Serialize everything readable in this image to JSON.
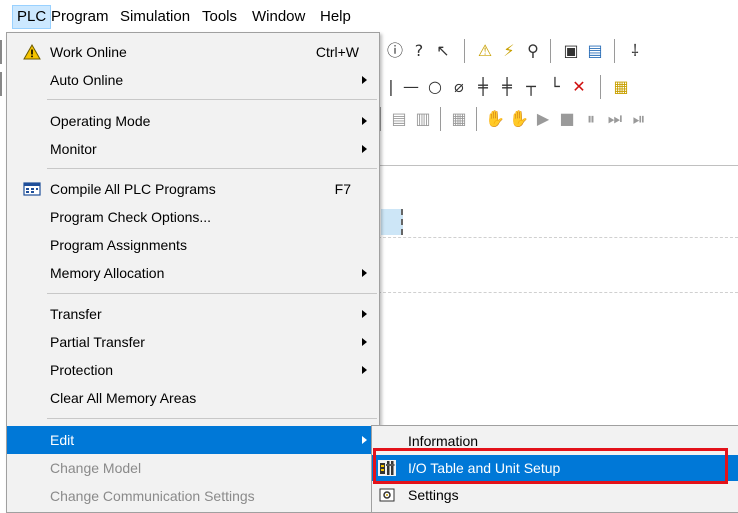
{
  "menubar": {
    "items": [
      {
        "label": "PLC",
        "active": true
      },
      {
        "label": "Program"
      },
      {
        "label": "Simulation"
      },
      {
        "label": "Tools"
      },
      {
        "label": "Window"
      },
      {
        "label": "Help"
      }
    ]
  },
  "plc_menu": {
    "work_online": {
      "label": "Work Online",
      "shortcut": "Ctrl+W"
    },
    "auto_online": {
      "label": "Auto Online"
    },
    "operating_mode": {
      "label": "Operating Mode"
    },
    "monitor": {
      "label": "Monitor"
    },
    "compile_all": {
      "label": "Compile All PLC Programs",
      "shortcut": "F7"
    },
    "program_check": {
      "label": "Program Check Options..."
    },
    "program_assignments": {
      "label": "Program Assignments"
    },
    "memory_allocation": {
      "label": "Memory Allocation"
    },
    "transfer": {
      "label": "Transfer"
    },
    "partial_transfer": {
      "label": "Partial Transfer"
    },
    "protection": {
      "label": "Protection"
    },
    "clear_memory": {
      "label": "Clear All Memory Areas"
    },
    "edit": {
      "label": "Edit"
    },
    "change_model": {
      "label": "Change Model"
    },
    "change_comm": {
      "label": "Change Communication Settings"
    }
  },
  "edit_submenu": {
    "information": {
      "label": "Information"
    },
    "io_table": {
      "label": "I/O Table and Unit Setup"
    },
    "settings": {
      "label": "Settings"
    }
  },
  "colors": {
    "highlight": "#0078d7",
    "callout": "#e3121a",
    "menu_bg": "#f2f2f2"
  }
}
